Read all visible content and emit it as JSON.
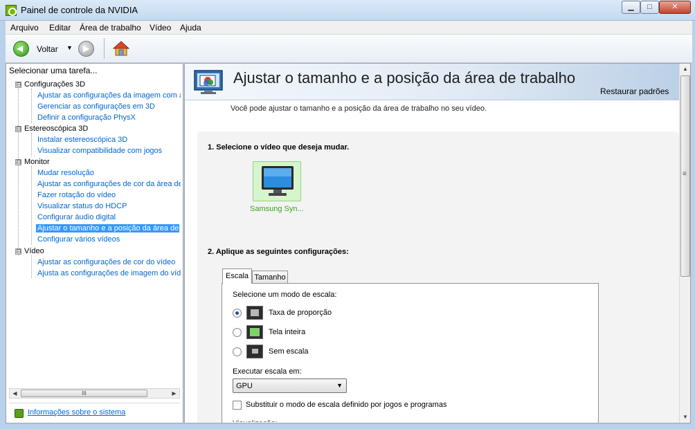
{
  "window": {
    "title": "Painel de controle da NVIDIA",
    "min_symbol": "▁",
    "max_symbol": "□",
    "close_symbol": "✕"
  },
  "menu": {
    "items": [
      {
        "label": "Arquivo"
      },
      {
        "label": "Editar"
      },
      {
        "label": "Área de trabalho"
      },
      {
        "label": "Vídeo"
      },
      {
        "label": "Ajuda"
      }
    ]
  },
  "toolbar": {
    "back_label": "Voltar",
    "dropdown_symbol": "▼"
  },
  "sidebar": {
    "heading": "Selecionar uma tarefa...",
    "categories": [
      {
        "label": "Configurações 3D",
        "toggle": "⊟"
      },
      {
        "label": "Estereoscópica 3D",
        "toggle": "⊟"
      },
      {
        "label": "Monitor",
        "toggle": "⊟"
      },
      {
        "label": "Vídeo",
        "toggle": "⊟"
      }
    ],
    "items": [
      {
        "label": "Ajustar as configurações da imagem com a"
      },
      {
        "label": "Gerenciar as configurações em 3D"
      },
      {
        "label": "Definir a configuração PhysX"
      },
      {
        "label": "Instalar estereoscópica 3D"
      },
      {
        "label": "Visualizar compatibilidade com jogos"
      },
      {
        "label": "Mudar resolução"
      },
      {
        "label": "Ajustar as configurações de cor da área de"
      },
      {
        "label": "Fazer rotação do vídeo"
      },
      {
        "label": "Visualizar status do HDCP"
      },
      {
        "label": "Configurar áudio digital"
      },
      {
        "label": "Ajustar o tamanho e a posição da área de"
      },
      {
        "label": "Configurar vários vídeos"
      },
      {
        "label": "Ajustar as configurações de cor do vídeo"
      },
      {
        "label": "Ajusta as configurações de imagem do víde"
      }
    ],
    "scroll_left": "◀",
    "scroll_thumb": "III",
    "scroll_right": "▶",
    "system_info": "Informações sobre o sistema"
  },
  "main": {
    "title": "Ajustar o tamanho e a posição da área de trabalho",
    "restore": "Restaurar padrões",
    "description": "Você pode ajustar o tamanho e a posição da área de trabalho no seu vídeo.",
    "step1": "1. Selecione o vídeo que deseja mudar.",
    "monitor_label": "Samsung Syn...",
    "step2": "2. Aplique as seguintes configurações:",
    "tabs": [
      {
        "label": "Escala"
      },
      {
        "label": "Tamanho"
      }
    ],
    "scale_heading": "Selecione um modo de escala:",
    "scale_options": [
      {
        "label": "Taxa de proporção"
      },
      {
        "label": "Tela inteira"
      },
      {
        "label": "Sem escala"
      }
    ],
    "selected_scale": "Taxa de proporção",
    "exec_label": "Executar escala em:",
    "exec_value": "GPU",
    "dropdown_symbol": "▼",
    "override_label": "Substituir o modo de escala definido por jogos e programas",
    "override_checked": false,
    "cut_label": "Visualização:"
  },
  "scrollbar": {
    "up": "▲",
    "down": "▼"
  }
}
